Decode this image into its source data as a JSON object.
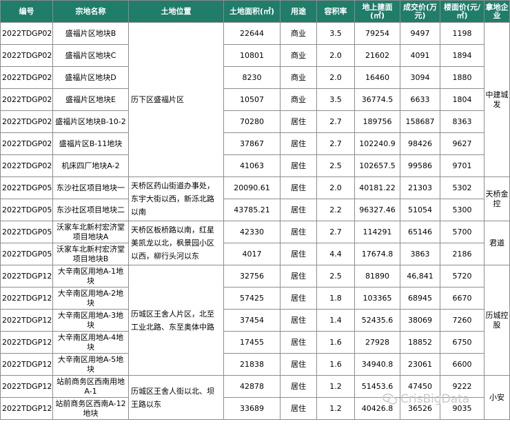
{
  "headers": [
    "编号",
    "宗地名称",
    "土地位置",
    "土地面积(㎡)",
    "用途",
    "容积率",
    "地上建面(㎡)",
    "成交价(万元)",
    "楼面价(元/㎡)",
    "拿地企业"
  ],
  "rows": [
    {
      "code": "2022TDGP02C0001",
      "name": "盛福片区地块B",
      "area": "22644",
      "use": "商业",
      "far": "3.5",
      "gfa": "79254",
      "price": "9497",
      "unit": "1198"
    },
    {
      "code": "2022TDGP02C0002",
      "name": "盛福片区地块C",
      "area": "10801",
      "use": "商业",
      "far": "2.0",
      "gfa": "21602",
      "price": "4091",
      "unit": "1894"
    },
    {
      "code": "2022TDGP02C0003",
      "name": "盛福片区地块D",
      "area": "8230",
      "use": "商业",
      "far": "2.0",
      "gfa": "16460",
      "price": "3094",
      "unit": "1880"
    },
    {
      "code": "2022TDGP02C0004",
      "name": "盛福片区地块E",
      "area": "10507",
      "use": "商业",
      "far": "3.5",
      "gfa": "36774.5",
      "price": "6633",
      "unit": "1804"
    },
    {
      "code": "2022TDGP02R0005",
      "name": "盛福片区地块B-10-2",
      "area": "70280",
      "use": "居住",
      "far": "2.7",
      "gfa": "189756",
      "price": "158687",
      "unit": "8363"
    },
    {
      "code": "2022TDGP02R0006",
      "name": "盛福片区B-11地块",
      "area": "37867",
      "use": "居住",
      "far": "2.7",
      "gfa": "102240.9",
      "price": "98426",
      "unit": "9627"
    },
    {
      "code": "2022TDGP02R0007",
      "name": "机床四厂地块A-2",
      "area": "41063",
      "use": "居住",
      "far": "2.5",
      "gfa": "102657.5",
      "price": "99586",
      "unit": "9701"
    },
    {
      "code": "2022TDGP05R0011",
      "name": "东沙社区项目地块一",
      "area": "20090.61",
      "use": "居住",
      "far": "2.0",
      "gfa": "40181.22",
      "price": "21303",
      "unit": "5302"
    },
    {
      "code": "2022TDGP05R0012",
      "name": "东沙社区项目地块二",
      "area": "43785.21",
      "use": "居住",
      "far": "2.2",
      "gfa": "96327.46",
      "price": "51054",
      "unit": "5300"
    },
    {
      "code": "2022TDGP05R0031",
      "name": "沃家车北新村宏济堂项目地块A",
      "area": "42330",
      "use": "居住",
      "far": "2.7",
      "gfa": "114291",
      "price": "65146",
      "unit": "5700"
    },
    {
      "code": "2022TDGP05C0032",
      "name": "沃家车北新村宏济堂项目地块B",
      "area": "4017",
      "use": "居住",
      "far": "4.4",
      "gfa": "17674.8",
      "price": "3863",
      "unit": "2186"
    },
    {
      "code": "2022TDGP12R0013",
      "name": "大辛南区用地A-1地块",
      "area": "32756",
      "use": "居住",
      "far": "2.5",
      "gfa": "81890",
      "price": "46,841",
      "unit": "5720"
    },
    {
      "code": "2022TDGP12R0014",
      "name": "大辛南区用地A-2地块",
      "area": "57425",
      "use": "居住",
      "far": "1.8",
      "gfa": "103365",
      "price": "68945",
      "unit": "6670"
    },
    {
      "code": "2022TDGP12R0015",
      "name": "大辛南区用地A-3地块",
      "area": "37454",
      "use": "居住",
      "far": "1.4",
      "gfa": "52435.6",
      "price": "38069",
      "unit": "7260"
    },
    {
      "code": "2022TDGP12R0016",
      "name": "大辛南区用地A-4地块",
      "area": "17455",
      "use": "居住",
      "far": "1.6",
      "gfa": "27928",
      "price": "18852",
      "unit": "6750"
    },
    {
      "code": "2022TDGP12R0017",
      "name": "大辛南区用地A-5地块",
      "area": "21838",
      "use": "居住",
      "far": "1.6",
      "gfa": "34940.8",
      "price": "23061",
      "unit": "6600"
    },
    {
      "code": "2022TDGP12R0029",
      "name": "站前商务区西南用地A-1",
      "area": "42878",
      "use": "居住",
      "far": "1.2",
      "gfa": "51453.6",
      "price": "47450",
      "unit": "9222"
    },
    {
      "code": "2022TDGP12R0030",
      "name": "站前商务区西南A-12地块",
      "area": "33689",
      "use": "居住",
      "far": "1.2",
      "gfa": "40426.8",
      "price": "36526",
      "unit": "9035"
    }
  ],
  "locations": [
    "历下区盛福片区",
    "天桥区药山街道办事处，东宇大街以西，新泺北路以南",
    "天桥区板桥路以南，红星美凯龙以北，枫景园小区以西，柳行头河以东",
    "历城区王舍人片区，北至工业北路、东至奥体中路",
    "历城区王舍人街以北、坝王路以东"
  ],
  "winners": [
    "中建城发",
    "天桥金控",
    "君道",
    "历城控股",
    "小安"
  ],
  "watermark": "CrisBigData",
  "colors": {
    "header_bg": "#1f7d6a",
    "header_text": "#ffffff",
    "border": "#8c8c8c"
  }
}
